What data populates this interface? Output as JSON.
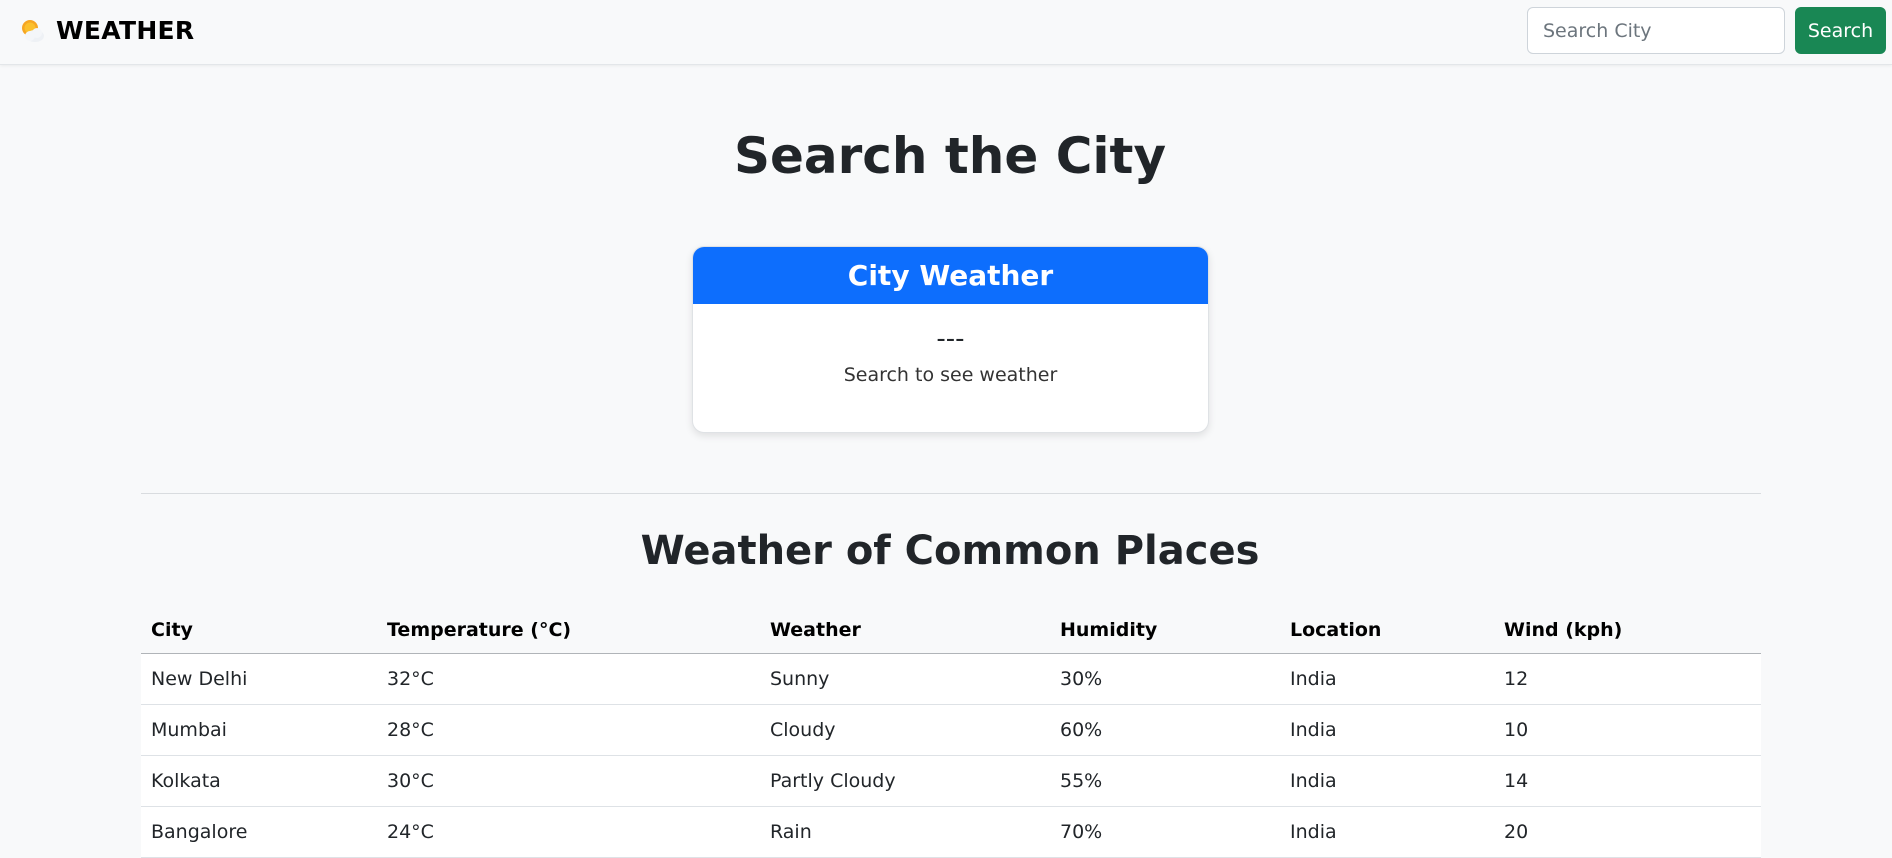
{
  "navbar": {
    "brand": "WEATHER",
    "brand_icon": "sun-behind-cloud-icon",
    "search_placeholder": "Search City",
    "search_value": "",
    "search_button": "Search",
    "colors": {
      "search_button": "#198754"
    }
  },
  "main": {
    "title": "Search the City",
    "card": {
      "header": "City Weather",
      "temp": "---",
      "description": "Search to see weather",
      "colors": {
        "header": "#0d6efd"
      }
    }
  },
  "common": {
    "title": "Weather of Common Places",
    "columns": [
      "City",
      "Temperature (°C)",
      "Weather",
      "Humidity",
      "Location",
      "Wind (kph)"
    ],
    "rows": [
      [
        "New Delhi",
        "32°C",
        "Sunny",
        "30%",
        "India",
        "12"
      ],
      [
        "Mumbai",
        "28°C",
        "Cloudy",
        "60%",
        "India",
        "10"
      ],
      [
        "Kolkata",
        "30°C",
        "Partly Cloudy",
        "55%",
        "India",
        "14"
      ],
      [
        "Bangalore",
        "24°C",
        "Rain",
        "70%",
        "India",
        "20"
      ]
    ]
  }
}
